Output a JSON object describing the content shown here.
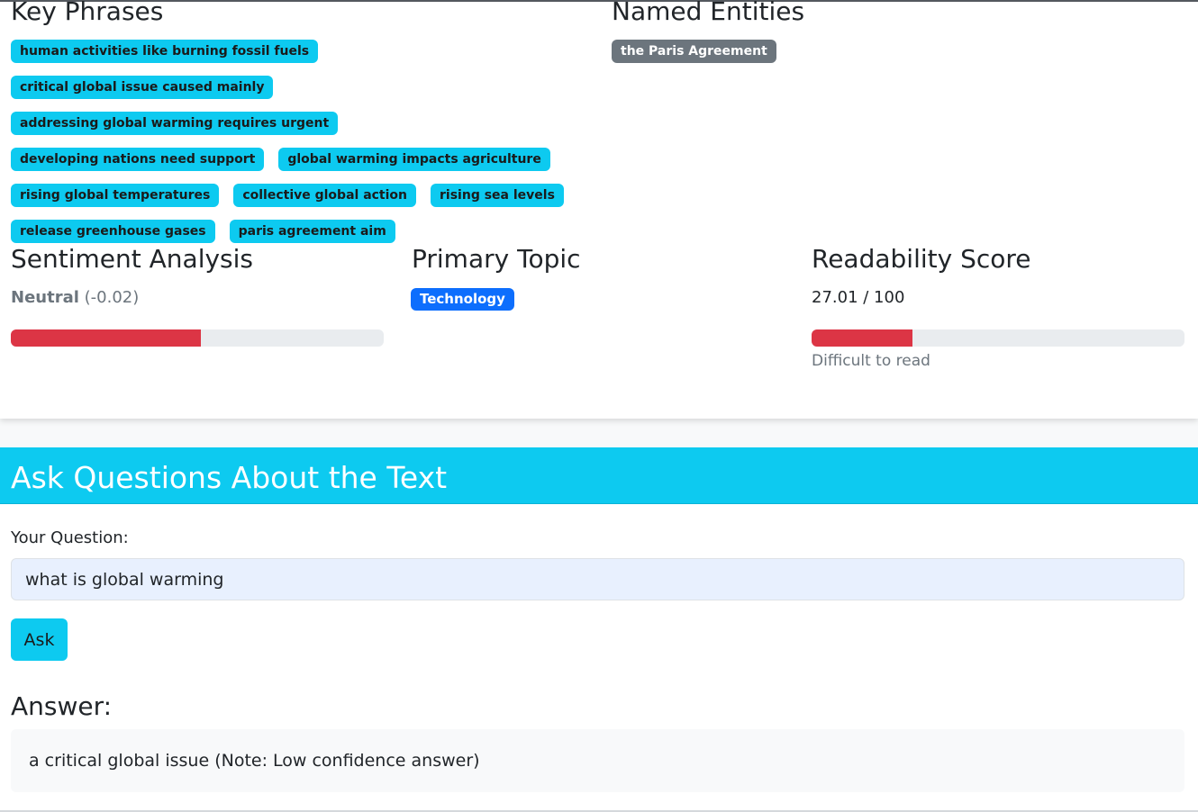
{
  "key_phrases": {
    "title": "Key Phrases",
    "items": [
      "human activities like burning fossil fuels",
      "critical global issue caused mainly",
      "addressing global warming requires urgent",
      "developing nations need support",
      "global warming impacts agriculture",
      "rising global temperatures",
      "collective global action",
      "rising sea levels",
      "release greenhouse gases",
      "paris agreement aim"
    ]
  },
  "named_entities": {
    "title": "Named Entities",
    "items": [
      "the Paris Agreement"
    ]
  },
  "sentiment": {
    "title": "Sentiment Analysis",
    "label": "Neutral",
    "score_text": "(-0.02)",
    "bar_fraction": 0.51
  },
  "topic": {
    "title": "Primary Topic",
    "label": "Technology"
  },
  "readability": {
    "title": "Readability Score",
    "score_text": "27.01 / 100",
    "score": 27.01,
    "max": 100,
    "description": "Difficult to read"
  },
  "qa": {
    "title": "Ask Questions About the Text",
    "question_label": "Your Question:",
    "question_value": "what is global warming",
    "ask_label": "Ask",
    "answer_title": "Answer:",
    "answer_text": "a critical global issue (Note: Low confidence answer)"
  },
  "colors": {
    "accent": "#0dcaf0",
    "entity_badge": "#6c757d",
    "topic_badge": "#0d6efd",
    "bar_fill": "#dc3545",
    "bar_track": "#e9ecef"
  }
}
